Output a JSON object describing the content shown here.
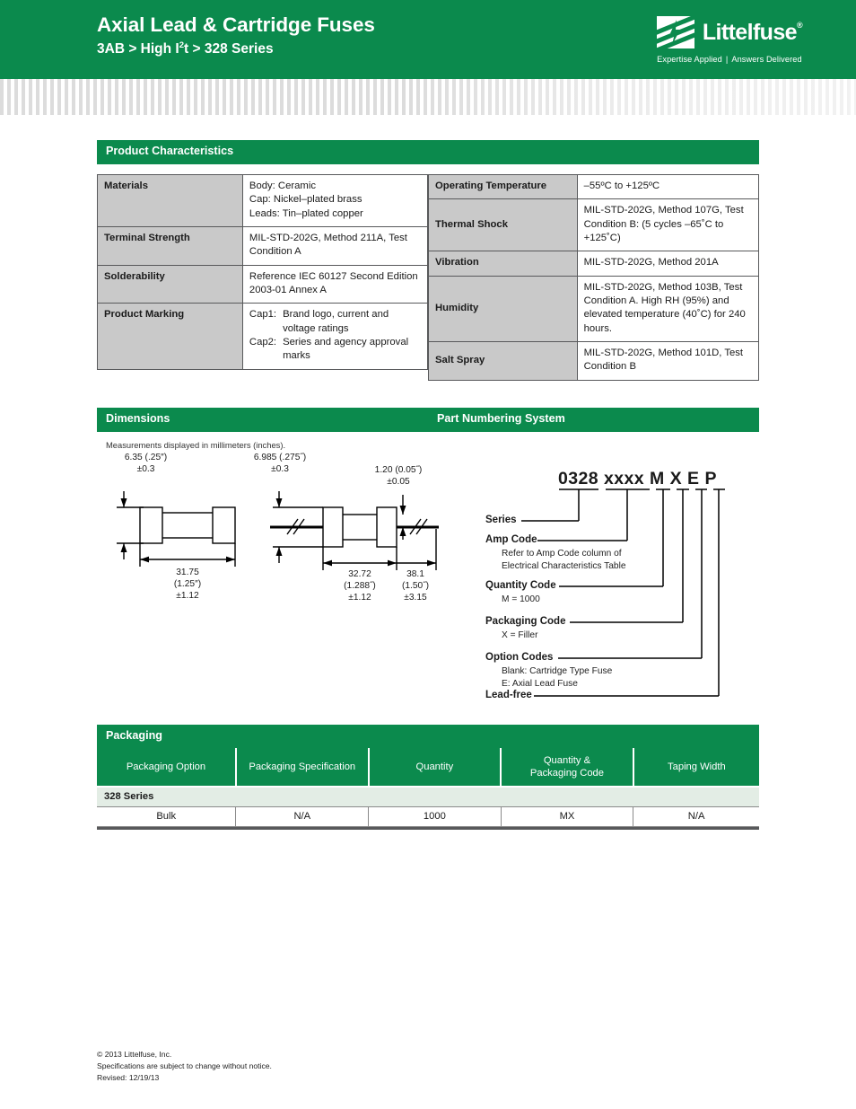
{
  "header": {
    "title": "Axial Lead & Cartridge Fuses",
    "breadcrumb_pre": "3AB > High I",
    "breadcrumb_sup": "2",
    "breadcrumb_post": "t > 328 Series",
    "logo_word": "Littelfuse",
    "logo_reg": "®",
    "tagline_left": "Expertise Applied",
    "tagline_sep": "|",
    "tagline_right": "Answers Delivered",
    "green": "#0b8a4d"
  },
  "product_characteristics": {
    "section_title": "Product Characteristics",
    "rows": [
      {
        "key": "Materials",
        "value": "Body: Ceramic\nCap: Nickel–plated brass\nLeads: Tin–plated copper"
      },
      {
        "key": "Terminal Strength",
        "value": "MIL-STD-202G, Method 211A, Test Condition A"
      },
      {
        "key": "Solderability",
        "value": "Reference IEC 60127 Second Edition 2003-01 Annex A"
      }
    ],
    "marking": {
      "key": "Product Marking",
      "lines": [
        {
          "label": "Cap1:",
          "text": "Brand logo, current and voltage ratings"
        },
        {
          "label": "Cap2:",
          "text": "Series and agency approval marks"
        }
      ]
    }
  },
  "environmental": {
    "rows": [
      {
        "key": "Operating Temperature",
        "value": "–55ºC to +125ºC"
      },
      {
        "key": "Thermal Shock",
        "value": "MIL-STD-202G, Method 107G, Test Condition B: (5 cycles –65˚C to +125˚C)"
      },
      {
        "key": "Vibration",
        "value": "MIL-STD-202G, Method 201A"
      },
      {
        "key": "Humidity",
        "value": "MIL-STD-202G, Method 103B, Test Condition A. High RH (95%) and elevated temperature (40˚C) for 240 hours."
      },
      {
        "key": "Salt Spray",
        "value": "MIL-STD-202G, Method 101D, Test Condition B"
      }
    ]
  },
  "dimensions": {
    "section_title": "Dimensions",
    "note": "Measurements displayed in millimeters (inches).",
    "cartridge": {
      "diameter_value": "6.35 (.25″)",
      "diameter_tol": "±0.3",
      "length_value": "31.75",
      "length_inch": "(1.25″)",
      "length_tol": "±1.12"
    },
    "axial": {
      "diameter_value": "6.985 (.275˝)",
      "diameter_tol": "±0.3",
      "lead_dia_value": "1.20 (0.05˝)",
      "lead_dia_tol": "±0.05",
      "body_value": "32.72",
      "body_inch": "(1.288˝)",
      "body_tol": "±1.12",
      "lead_len_value": "38.1",
      "lead_len_inch": "(1.50˝)",
      "lead_len_tol": "±3.15"
    }
  },
  "part_numbering": {
    "section_title": "Part Numbering System",
    "code": {
      "series": "0328",
      "amp": "xxxx",
      "quantity": "M",
      "packaging": "X",
      "option": "E",
      "leadfree": "P"
    },
    "items": [
      {
        "title": "Series",
        "desc": ""
      },
      {
        "title": "Amp Code",
        "desc": "Refer to Amp Code column of\nElectrical Characteristics Table"
      },
      {
        "title": "Quantity Code",
        "desc": "M  =  1000"
      },
      {
        "title": "Packaging Code",
        "desc": "X  =  Filler"
      },
      {
        "title": "Option Codes",
        "desc": "Blank: Cartridge Type Fuse\nE: Axial Lead Fuse"
      },
      {
        "title": "Lead-free",
        "desc": ""
      }
    ]
  },
  "packaging": {
    "section_title": "Packaging",
    "columns": [
      "Packaging Option",
      "Packaging Specification",
      "Quantity",
      "Quantity &\nPackaging Code",
      "Taping Width"
    ],
    "series_label": "328 Series",
    "rows": [
      [
        "Bulk",
        "N/A",
        "1000",
        "MX",
        "N/A"
      ]
    ]
  },
  "footer": {
    "line1": "© 2013 Littelfuse, Inc.",
    "line2": "Specifications are subject to change without notice.",
    "line3": "Revised: 12/19/13"
  }
}
